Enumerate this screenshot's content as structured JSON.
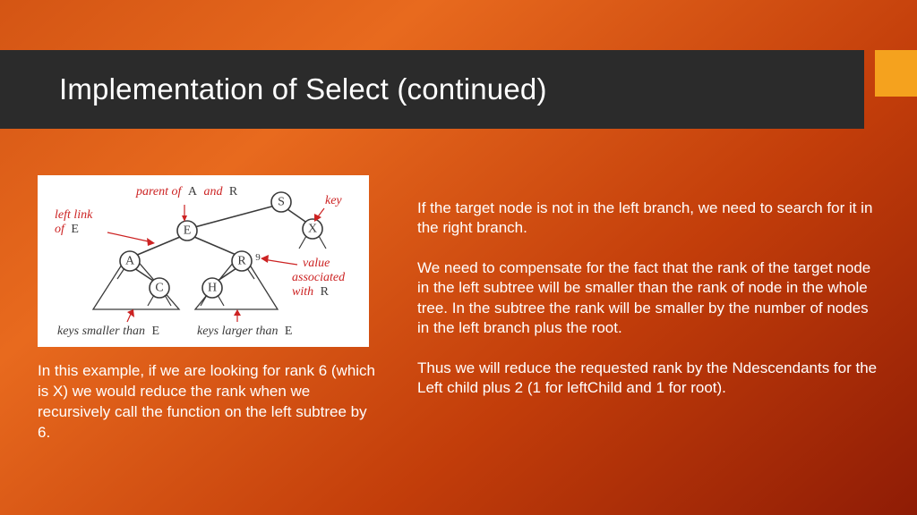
{
  "title": "Implementation of Select (continued)",
  "diagram": {
    "label_parent": "parent of",
    "label_parent_nodes": "A and R",
    "label_leftlink1": "left link",
    "label_leftlink2": "of",
    "label_leftlink_node": "E",
    "label_key": "key",
    "label_value1": "value",
    "label_value2": "associated",
    "label_value3": "with",
    "label_value_node": "R",
    "label_smaller": "keys smaller than",
    "label_smaller_node": "E",
    "label_larger": "keys larger than",
    "label_larger_node": "E",
    "r_value": "9",
    "nodes": {
      "S": "S",
      "E": "E",
      "X": "X",
      "A": "A",
      "R": "R",
      "C": "C",
      "H": "H"
    }
  },
  "caption": "In this example, if we are looking for rank 6 (which is X) we would reduce the rank when we recursively call the function on the left subtree by 6.",
  "body": {
    "p1": "If the target node is not in the left branch, we need to search for it in the right branch.",
    "p2": "We need to compensate for the fact that the rank of the target node in the left subtree will be smaller than the rank of node in the whole tree.  In the subtree the rank will be smaller by the number of nodes in the left branch plus the root.",
    "p3": "Thus we will reduce the requested rank by the Ndescendants for the Left child plus 2 (1 for leftChild and 1 for root)."
  }
}
